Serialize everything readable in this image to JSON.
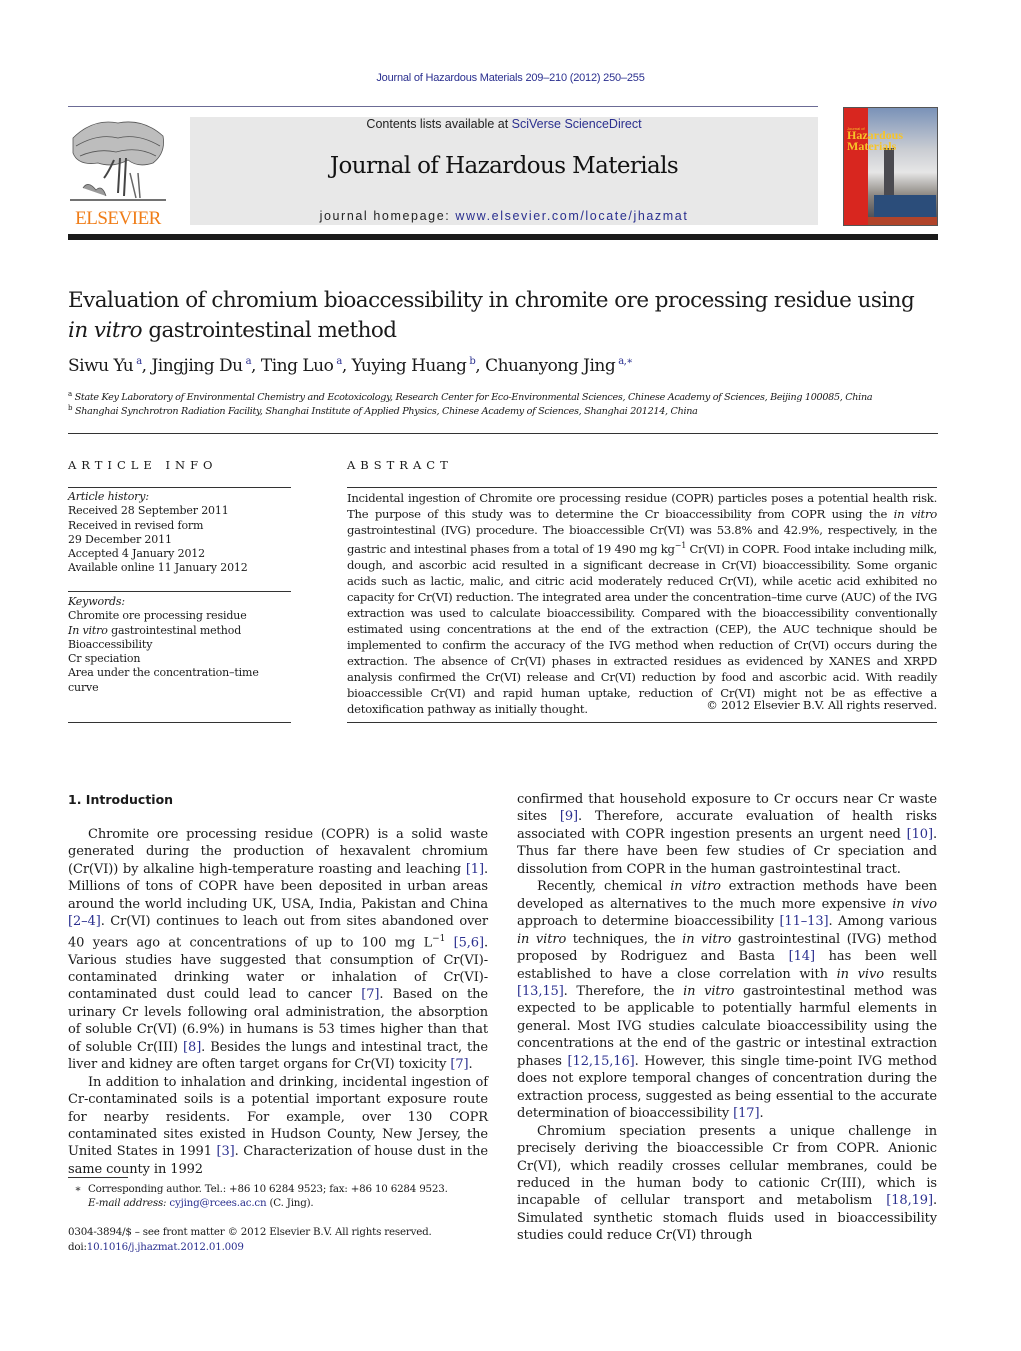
{
  "running_head": "Journal of Hazardous Materials 209–210 (2012) 250–255",
  "publisher": {
    "logo_text": "ELSEVIER",
    "logo_icon": "elsevier-tree-icon"
  },
  "banner": {
    "contents_prefix": "Contents lists available at ",
    "contents_link": "SciVerse ScienceDirect",
    "journal_name": "Journal of Hazardous Materials",
    "homepage_prefix": "journal homepage: ",
    "homepage_link": "www.elsevier.com/locate/jhazmat"
  },
  "cover": {
    "title_line1": "Hazardous",
    "title_line2": "Materials",
    "small_text": "Journal of"
  },
  "article": {
    "title_line1": "Evaluation of chromium bioaccessibility in chromite ore processing residue using",
    "title_line2_italic": "in vitro",
    "title_line2_rest": " gastrointestinal method",
    "authors": [
      {
        "name": "Siwu Yu",
        "sup": "a"
      },
      {
        "name": "Jingjing Du",
        "sup": "a"
      },
      {
        "name": "Ting Luo",
        "sup": "a"
      },
      {
        "name": "Yuying Huang",
        "sup": "b"
      },
      {
        "name": "Chuanyong Jing",
        "sup": "a,∗"
      }
    ],
    "affiliations": [
      {
        "mark": "a",
        "text": "State Key Laboratory of Environmental Chemistry and Ecotoxicology, Research Center for Eco-Environmental Sciences, Chinese Academy of Sciences, Beijing 100085, China"
      },
      {
        "mark": "b",
        "text": "Shanghai Synchrotron Radiation Facility, Shanghai Institute of Applied Physics, Chinese Academy of Sciences, Shanghai 201214, China"
      }
    ]
  },
  "article_info": {
    "heading": "ARTICLE INFO",
    "history_label": "Article history:",
    "history": [
      "Received 28 September 2011",
      "Received in revised form",
      "29 December 2011",
      "Accepted 4 January 2012",
      "Available online 11 January 2012"
    ],
    "keywords_label": "Keywords:",
    "keywords": [
      {
        "italic": "",
        "text": "Chromite ore processing residue"
      },
      {
        "italic": "In vitro",
        "text": " gastrointestinal method"
      },
      {
        "italic": "",
        "text": "Bioaccessibility"
      },
      {
        "italic": "",
        "text": "Cr speciation"
      },
      {
        "italic": "",
        "text": "Area under the concentration–time curve"
      }
    ]
  },
  "abstract": {
    "heading": "ABSTRACT",
    "part1": "Incidental ingestion of Chromite ore processing residue (COPR) particles poses a potential health risk. The purpose of this study was to determine the Cr bioaccessibility from COPR using the ",
    "part1_italic": "in vitro",
    "part2": " gastrointestinal (IVG) procedure. The bioaccessible Cr(VI) was 53.8% and 42.9%, respectively, in the gastric and intestinal phases from a total of 19 490 mg kg",
    "part2_sup": "−1",
    "part3": " Cr(VI) in COPR. Food intake including milk, dough, and ascorbic acid resulted in a significant decrease in Cr(VI) bioaccessibility. Some organic acids such as lactic, malic, and citric acid moderately reduced Cr(VI), while acetic acid exhibited no capacity for Cr(VI) reduction. The integrated area under the concentration–time curve (AUC) of the IVG extraction was used to calculate bioaccessibility. Compared with the bioaccessibility conventionally estimated using concentrations at the end of the extraction (CEP), the AUC technique should be implemented to confirm the accuracy of the IVG method when reduction of Cr(VI) occurs during the extraction. The absence of Cr(VI) phases in extracted residues as evidenced by XANES and XRPD analysis confirmed the Cr(VI) release and Cr(VI) reduction by food and ascorbic acid. With readily bioaccessible Cr(VI) and rapid human uptake, reduction of Cr(VI) might not be as effective a detoxification pathway as initially thought.",
    "copyright": "© 2012 Elsevier B.V. All rights reserved."
  },
  "intro": {
    "heading": "1.  Introduction",
    "left_p1": [
      {
        "t": "Chromite ore processing residue (COPR) is a solid waste generated during the production of hexavalent chromium (Cr(VI)) by alkaline high-temperature roasting and leaching "
      },
      {
        "ref": "[1]"
      },
      {
        "t": ". Millions of tons of COPR have been deposited in urban areas around the world including UK, USA, India, Pakistan and China "
      },
      {
        "ref": "[2–4]"
      },
      {
        "t": ". Cr(VI) continues to leach out from sites abandoned over 40 years ago at concentrations of up to 100 mg L"
      },
      {
        "sup": "−1"
      },
      {
        "t": " "
      },
      {
        "ref": "[5,6]"
      },
      {
        "t": ". Various studies have suggested that consumption of Cr(VI)-contaminated drinking water or inhalation of Cr(VI)-contaminated dust could lead to cancer "
      },
      {
        "ref": "[7]"
      },
      {
        "t": ". Based on the urinary Cr levels following oral administration, the absorption of soluble Cr(VI) (6.9%) in humans is 53 times higher than that of soluble Cr(III) "
      },
      {
        "ref": "[8]"
      },
      {
        "t": ". Besides the lungs and intestinal tract, the liver and kidney are often target organs for Cr(VI) toxicity "
      },
      {
        "ref": "[7]"
      },
      {
        "t": "."
      }
    ],
    "left_p2": [
      {
        "t": "In addition to inhalation and drinking, incidental ingestion of Cr-contaminated soils is a potential important exposure route for nearby residents. For example, over 130 COPR contaminated sites existed in Hudson County, New Jersey, the United States in 1991 "
      },
      {
        "ref": "[3]"
      },
      {
        "t": ". Characterization of house dust in the same county in 1992"
      }
    ],
    "right_p1": [
      {
        "t": "confirmed that household exposure to Cr occurs near Cr waste sites "
      },
      {
        "ref": "[9]"
      },
      {
        "t": ". Therefore, accurate evaluation of health risks associated with COPR ingestion presents an urgent need "
      },
      {
        "ref": "[10]"
      },
      {
        "t": ". Thus far there have been few studies of Cr speciation and dissolution from COPR in the human gastrointestinal tract."
      }
    ],
    "right_p2": [
      {
        "t": "Recently, chemical "
      },
      {
        "i": "in vitro"
      },
      {
        "t": " extraction methods have been developed as alternatives to the much more expensive "
      },
      {
        "i": "in vivo"
      },
      {
        "t": " approach to determine bioaccessibility "
      },
      {
        "ref": "[11–13]"
      },
      {
        "t": ". Among various "
      },
      {
        "i": "in vitro"
      },
      {
        "t": " techniques, the "
      },
      {
        "i": "in vitro"
      },
      {
        "t": " gastrointestinal (IVG) method proposed by Rodriguez and Basta "
      },
      {
        "ref": "[14]"
      },
      {
        "t": " has been well established to have a close correlation with "
      },
      {
        "i": "in vivo"
      },
      {
        "t": " results "
      },
      {
        "ref": "[13,15]"
      },
      {
        "t": ". Therefore, the "
      },
      {
        "i": "in vitro"
      },
      {
        "t": " gastrointestinal method was expected to be applicable to potentially harmful elements in general. Most IVG studies calculate bioaccessibility using the concentrations at the end of the gastric or intestinal extraction phases "
      },
      {
        "ref": "[12,15,16]"
      },
      {
        "t": ". However, this single time-point IVG method does not explore temporal changes of concentration during the extraction process, suggested as being essential to the accurate determination of bioaccessibility "
      },
      {
        "ref": "[17]"
      },
      {
        "t": "."
      }
    ],
    "right_p3": [
      {
        "t": "Chromium speciation presents a unique challenge in precisely deriving the bioaccessible Cr from COPR. Anionic Cr(VI), which readily crosses cellular membranes, could be reduced in the human body to cationic Cr(III), which is incapable of cellular transport and metabolism "
      },
      {
        "ref": "[18,19]"
      },
      {
        "t": ". Simulated synthetic stomach fluids used in bioaccessibility studies could reduce Cr(VI) through"
      }
    ]
  },
  "footnotes": {
    "corresponding_mark": "∗",
    "corresponding": "Corresponding author. Tel.: +86 10 6284 9523; fax: +86 10 6284 9523.",
    "email_label": "E-mail address:",
    "email": "cyjing@rcees.ac.cn",
    "email_suffix": " (C. Jing).",
    "front_matter": "0304-3894/$ – see front matter © 2012 Elsevier B.V. All rights reserved.",
    "doi_prefix": "doi:",
    "doi": "10.1016/j.jhazmat.2012.01.009"
  },
  "colors": {
    "link": "#2a2f8f",
    "elsevier_orange": "#f07d18",
    "banner_gray": "#e8e8e8",
    "cover_red": "#d8261f"
  }
}
